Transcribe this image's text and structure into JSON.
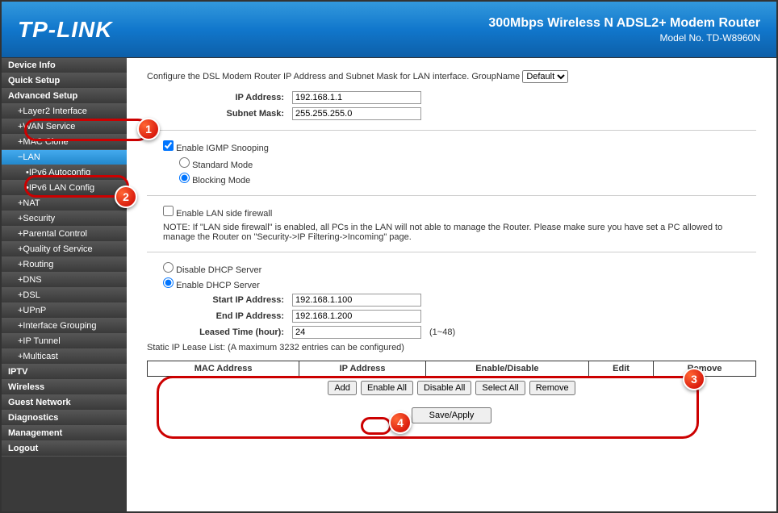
{
  "header": {
    "logo": "TP-LINK",
    "title": "300Mbps Wireless N ADSL2+ Modem Router",
    "model": "Model No. TD-W8960N"
  },
  "sidebar": {
    "items": [
      {
        "label": "Device Info",
        "cls": ""
      },
      {
        "label": "Quick Setup",
        "cls": ""
      },
      {
        "label": "Advanced Setup",
        "cls": ""
      },
      {
        "label": "+Layer2 Interface",
        "cls": "sub"
      },
      {
        "label": "+WAN Service",
        "cls": "sub"
      },
      {
        "label": "+MAC Clone",
        "cls": "sub"
      },
      {
        "label": "−LAN",
        "cls": "sub active"
      },
      {
        "label": "•IPv6 Autoconfig",
        "cls": "subsub"
      },
      {
        "label": "•IPv6 LAN Config",
        "cls": "subsub"
      },
      {
        "label": "+NAT",
        "cls": "sub"
      },
      {
        "label": "+Security",
        "cls": "sub"
      },
      {
        "label": "+Parental Control",
        "cls": "sub"
      },
      {
        "label": "+Quality of Service",
        "cls": "sub"
      },
      {
        "label": "+Routing",
        "cls": "sub"
      },
      {
        "label": "+DNS",
        "cls": "sub"
      },
      {
        "label": "+DSL",
        "cls": "sub"
      },
      {
        "label": "+UPnP",
        "cls": "sub"
      },
      {
        "label": "+Interface Grouping",
        "cls": "sub"
      },
      {
        "label": "+IP Tunnel",
        "cls": "sub"
      },
      {
        "label": "+Multicast",
        "cls": "sub"
      },
      {
        "label": "IPTV",
        "cls": ""
      },
      {
        "label": "Wireless",
        "cls": ""
      },
      {
        "label": "Guest Network",
        "cls": ""
      },
      {
        "label": "Diagnostics",
        "cls": ""
      },
      {
        "label": "Management",
        "cls": ""
      },
      {
        "label": "Logout",
        "cls": ""
      }
    ]
  },
  "main": {
    "desc": "Configure the DSL Modem Router IP Address and Subnet Mask for LAN interface.  GroupName",
    "groupname": "Default",
    "ip_label": "IP Address:",
    "ip_value": "192.168.1.1",
    "mask_label": "Subnet Mask:",
    "mask_value": "255.255.255.0",
    "igmp_label": "Enable IGMP Snooping",
    "std_mode": "Standard Mode",
    "blk_mode": "Blocking Mode",
    "lan_fw": "Enable LAN side firewall",
    "lan_fw_note": "NOTE: If \"LAN side firewall\" is enabled, all PCs in the LAN will not able to manage the Router. Please make sure you have set a PC allowed to manage the Router on \"Security->IP Filtering->Incoming\" page.",
    "dhcp_disable": "Disable DHCP Server",
    "dhcp_enable": "Enable DHCP Server",
    "start_ip_label": "Start IP Address:",
    "start_ip": "192.168.1.100",
    "end_ip_label": "End IP Address:",
    "end_ip": "192.168.1.200",
    "leased_label": "Leased Time (hour):",
    "leased": "24",
    "leased_hint": "(1~48)",
    "static_caption": "Static IP Lease List: (A maximum 3232 entries can be configured)",
    "cols": [
      "MAC Address",
      "IP Address",
      "Enable/Disable",
      "Edit",
      "Remove"
    ],
    "btns": {
      "add": "Add",
      "enable_all": "Enable All",
      "disable_all": "Disable All",
      "select_all": "Select All",
      "remove": "Remove"
    },
    "save": "Save/Apply"
  }
}
